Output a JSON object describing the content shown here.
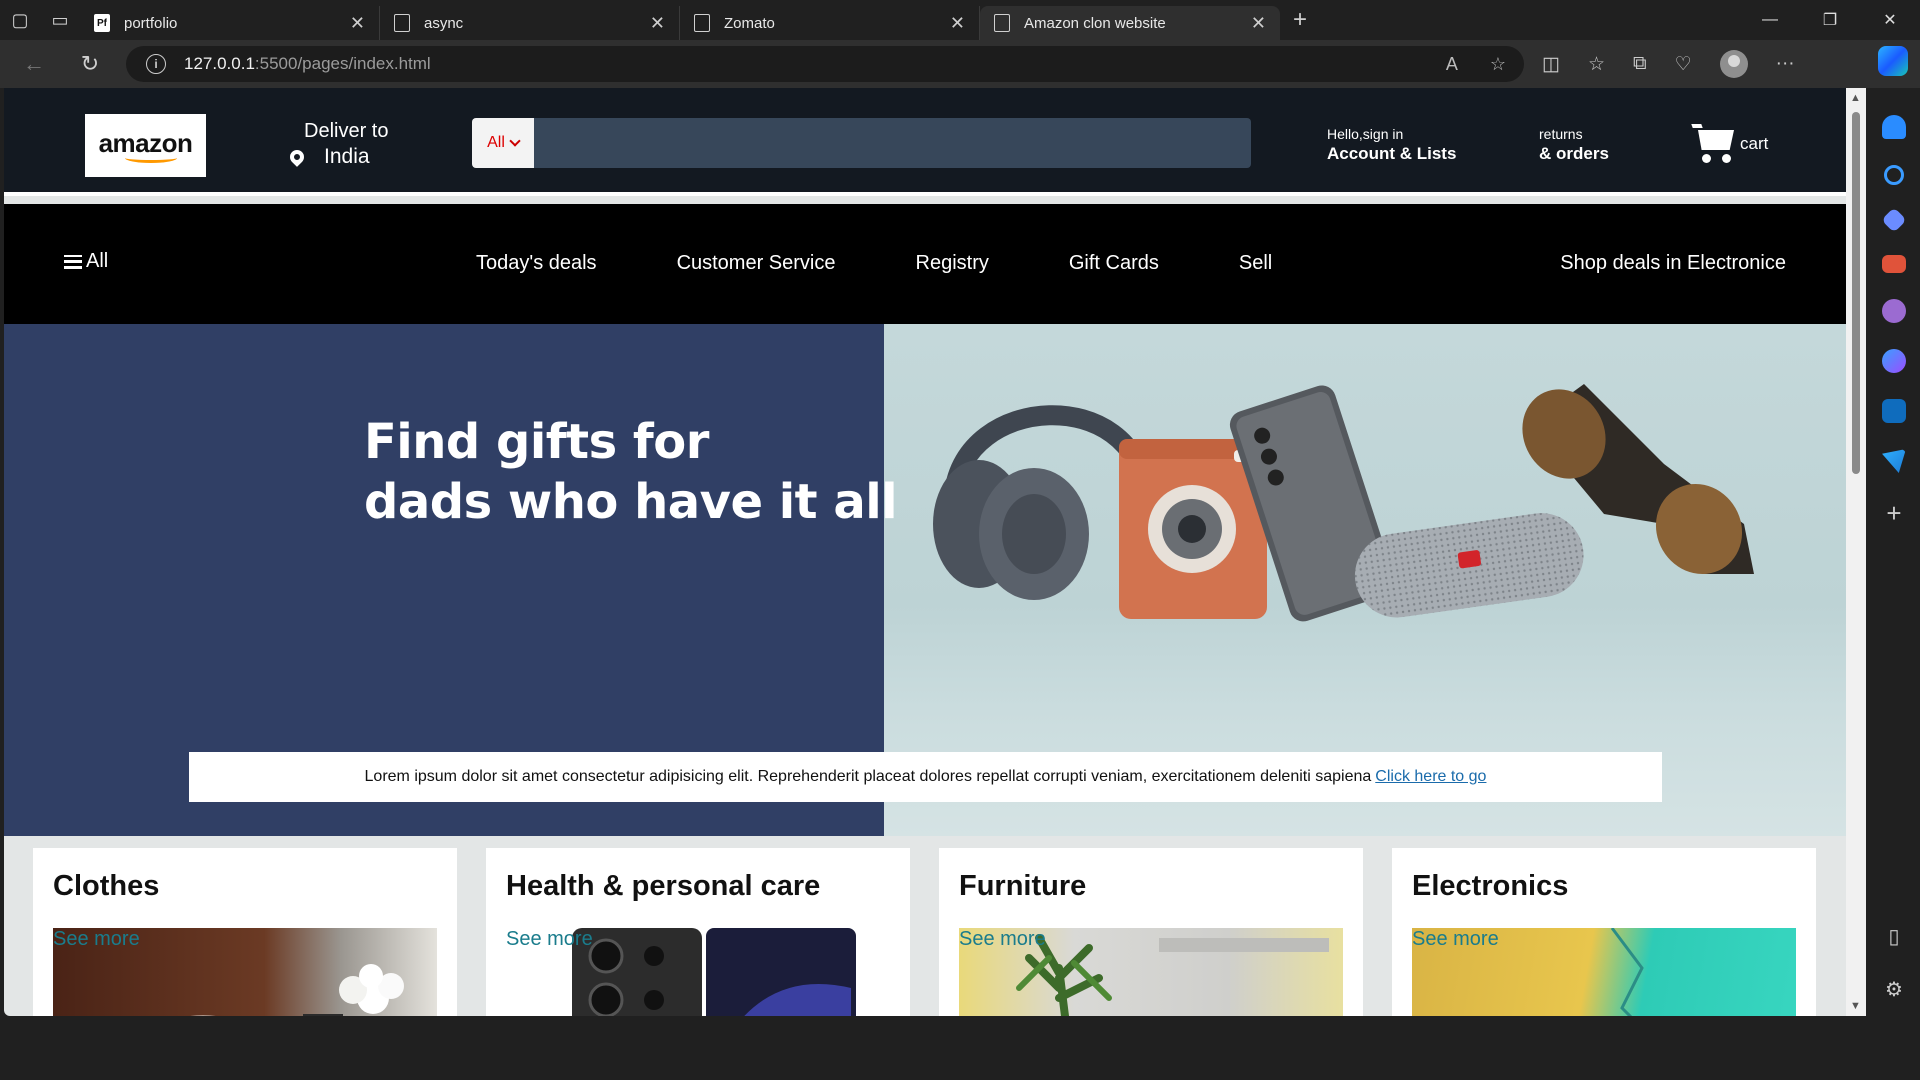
{
  "browser": {
    "tabs": [
      {
        "label": "portfolio",
        "favicon": "pf-icon"
      },
      {
        "label": "async",
        "favicon": "page-icon"
      },
      {
        "label": "Zomato",
        "favicon": "page-icon"
      },
      {
        "label": "Amazon clon website",
        "favicon": "page-icon",
        "active": true
      }
    ],
    "url_host": "127.0.0.1",
    "url_path": ":5500/pages/index.html"
  },
  "header": {
    "logo_text": "amazon",
    "deliver_line1": "Deliver to",
    "deliver_line2": "India",
    "search_category": "All",
    "search_placeholder": "",
    "account_small": "Hello,sign in",
    "account_big": "Account & Lists",
    "returns_small": "returns",
    "returns_big": "& orders",
    "cart_label": "cart"
  },
  "nav": {
    "all_label": "All",
    "links": [
      "Today's deals",
      "Customer Service",
      "Registry",
      "Gift Cards",
      "Sell"
    ],
    "shop_label": "Shop deals in Electronice"
  },
  "hero": {
    "headline_line1": "Find gifts for",
    "headline_line2": "dads who have it all",
    "notice_text": "Lorem ipsum dolor sit amet consectetur adipisicing elit. Reprehenderit placeat dolores repellat corrupti veniam, exercitationem deleniti sapiena",
    "notice_link": "Click here to go"
  },
  "cards": [
    {
      "title": "Clothes",
      "link": "See more"
    },
    {
      "title": "Health & personal care",
      "link": "See more"
    },
    {
      "title": "Furniture",
      "link": "See more"
    },
    {
      "title": "Electronics",
      "link": "See more"
    }
  ],
  "colors": {
    "amazon_dark": "#131921",
    "hero_blue": "#303f65",
    "search_bg": "#37475a",
    "accent_orange": "#ff9900"
  }
}
